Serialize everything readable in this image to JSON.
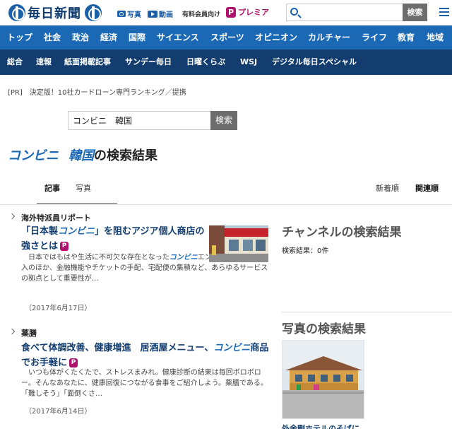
{
  "header": {
    "logo_text": "毎日新聞",
    "photos_label": "写真",
    "video_label": "動画",
    "member_label": "有料会員向け",
    "premia_badge": "P",
    "premia_label": "プレミア",
    "search_value": "",
    "search_button": "検索",
    "accent_color": "#1b68b5"
  },
  "nav_primary": [
    "トップ",
    "社会",
    "政治",
    "経済",
    "国際",
    "サイエンス",
    "スポーツ",
    "オピニオン",
    "カルチャー",
    "ライフ",
    "教育",
    "地域"
  ],
  "nav_secondary": [
    "総合",
    "速報",
    "紙面掲載記事",
    "サンデー毎日",
    "日曜くらぶ",
    "WSJ",
    "デジタル毎日スペシャル"
  ],
  "pr_text": "[PR]　決定版！10社カードローン専門ランキング／提携",
  "search": {
    "value": "コンビニ　韓国",
    "button": "検索"
  },
  "result_title": {
    "kw1": "コンビニ",
    "kw2": "韓国",
    "suffix": "の検索結果"
  },
  "tabs": {
    "articles": "記事",
    "photos": "写真",
    "newest": "新着順",
    "relevance": "関連順"
  },
  "articles": [
    {
      "category": "海外特派員リポート",
      "title_part1": "「日本製",
      "title_hl": "コンビニ",
      "title_part2": "」を阻むアジア個人商店の強さとは",
      "premium_badge": "P",
      "body_part1": "日本ではもはや生活に不可欠な存在となった",
      "body_hl": "コンビニ",
      "body_part2": "エンスストア。商品購入のほか、金融機能やチケットの手配、宅配便の集積など、あらゆるサービスの拠点として重要性が…",
      "date": "（2017年6月17日）"
    },
    {
      "category": "薬膳",
      "title_part1": "食べて体調改善、健康増進　居酒屋メニュー、",
      "title_hl": "コンビニ",
      "title_part2": "商品でお手軽に",
      "premium_badge": "P",
      "body_part1": "いつも体がくたくたで、ストレスまみれ。健康診断の結果は毎回ボロボロー。そんなあなたに、健康回復につながる食事をご紹介しよう。薬膳である。「難しそう」「面倒くさ…",
      "body_hl": "",
      "body_part2": "",
      "date": "（2017年6月14日）"
    }
  ],
  "right": {
    "channel_heading": "チャンネルの検索結果",
    "channel_count": "検索結果：0件",
    "photo_heading": "写真の検索結果",
    "photo_caption": "外金剛ホテルのそばに"
  }
}
